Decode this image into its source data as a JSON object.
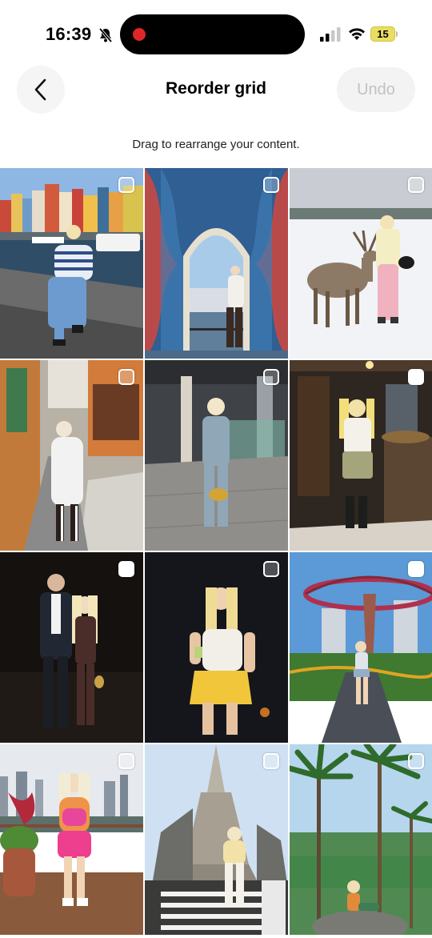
{
  "status_bar": {
    "time": "16:39",
    "battery_level": "15",
    "icons": [
      "bell-slash-icon",
      "signal-icon",
      "wifi-icon",
      "battery-icon"
    ],
    "recording_color": "#e02626"
  },
  "header": {
    "title": "Reorder grid",
    "undo_label": "Undo",
    "back_icon": "chevron-left-icon"
  },
  "subtitle": "Drag to rearrange your content.",
  "grid": {
    "tiles": [
      {
        "name": "tile-1",
        "scene": "canal-harbour-colorful-houses"
      },
      {
        "name": "tile-2",
        "scene": "mural-archway"
      },
      {
        "name": "tile-3",
        "scene": "reindeer-snow"
      },
      {
        "name": "tile-4",
        "scene": "street-white-coat"
      },
      {
        "name": "tile-5",
        "scene": "lobby-denim-outfit"
      },
      {
        "name": "tile-6",
        "scene": "restaurant-interior"
      },
      {
        "name": "tile-7",
        "scene": "couple-night"
      },
      {
        "name": "tile-8",
        "scene": "night-yellow-skirt"
      },
      {
        "name": "tile-9",
        "scene": "supertree-garden"
      },
      {
        "name": "tile-10",
        "scene": "city-balcony-pink-outfit"
      },
      {
        "name": "tile-11",
        "scene": "temple-stairs"
      },
      {
        "name": "tile-12",
        "scene": "palm-trees-tropical"
      }
    ]
  }
}
